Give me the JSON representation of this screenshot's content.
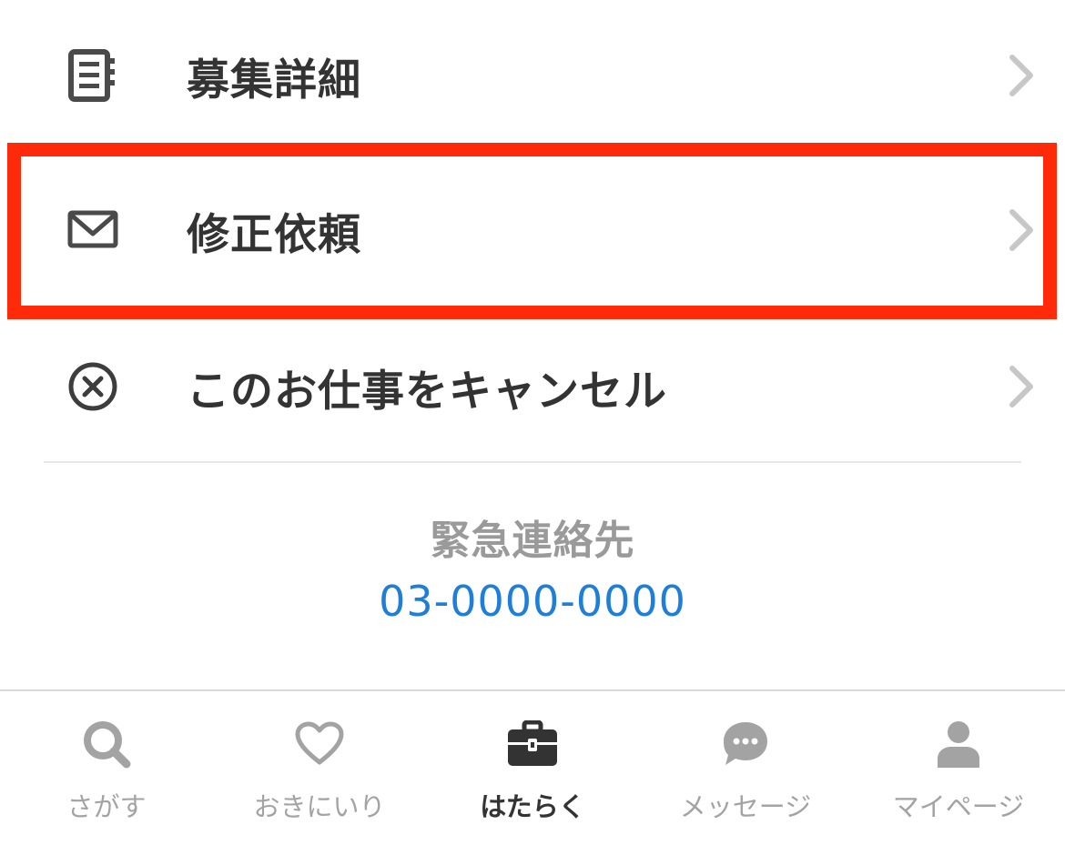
{
  "menu": {
    "items": [
      {
        "label": "募集詳細",
        "icon": "document-icon"
      },
      {
        "label": "修正依頼",
        "icon": "mail-icon",
        "highlighted": true
      },
      {
        "label": "このお仕事をキャンセル",
        "icon": "cancel-circle-icon"
      }
    ]
  },
  "emergency": {
    "title": "緊急連絡先",
    "phone": "03-0000-0000"
  },
  "tabbar": {
    "tabs": [
      {
        "label": "さがす",
        "icon": "search-icon",
        "active": false
      },
      {
        "label": "おきにいり",
        "icon": "heart-icon",
        "active": false
      },
      {
        "label": "はたらく",
        "icon": "briefcase-icon",
        "active": true
      },
      {
        "label": "メッセージ",
        "icon": "chat-bubble-icon",
        "active": false
      },
      {
        "label": "マイページ",
        "icon": "person-icon",
        "active": false
      }
    ]
  },
  "colors": {
    "highlight": "#ff2a0a",
    "link": "#1f7ed8",
    "text": "#333333",
    "muted": "#a3a3a3"
  }
}
